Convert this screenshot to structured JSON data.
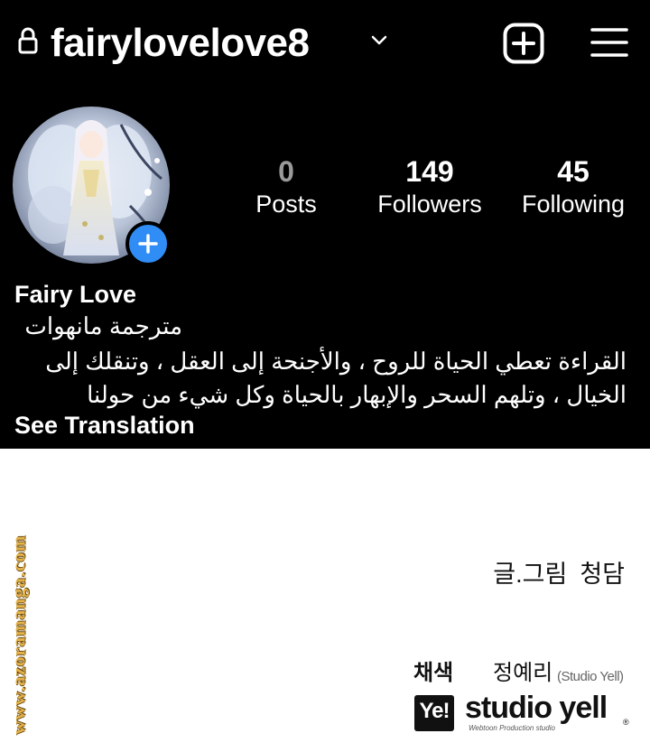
{
  "profile": {
    "username": "fairylovelove8",
    "stats": {
      "posts_count": "0",
      "posts_label": "Posts",
      "followers_count": "149",
      "followers_label": "Followers",
      "following_count": "45",
      "following_label": "Following"
    },
    "display_name": "Fairy Love",
    "bio_line1": "مترجمة مانهوات",
    "bio_line2": "القراءة تعطي الحياة للروح ، والأجنحة إلى العقل ، وتنقلك إلى الخيال ، وتلهم السحر والإبهار بالحياة وكل شيء من حولنا",
    "see_translation": "See Translation"
  },
  "icons": {
    "lock": "lock-icon",
    "dropdown": "chevron-down-icon",
    "new_post": "add-square-icon",
    "menu": "hamburger-menu-icon",
    "add_story": "plus-circle-icon"
  },
  "colors": {
    "panel_bg": "#000000",
    "accent_blue": "#2f8df5",
    "posts_gray": "#9a9a9a"
  },
  "credits": {
    "writer_label": "글.그림",
    "writer_name": "청담",
    "colorist_label": "채색",
    "colorist_name": "정예리",
    "colorist_studio": "(Studio Yell)",
    "studio_mark": "Ye!",
    "studio_name": "studio yell",
    "studio_tagline": "Webtoon Production studio",
    "studio_reg": "®"
  },
  "watermark": "www.azoramanga.com"
}
